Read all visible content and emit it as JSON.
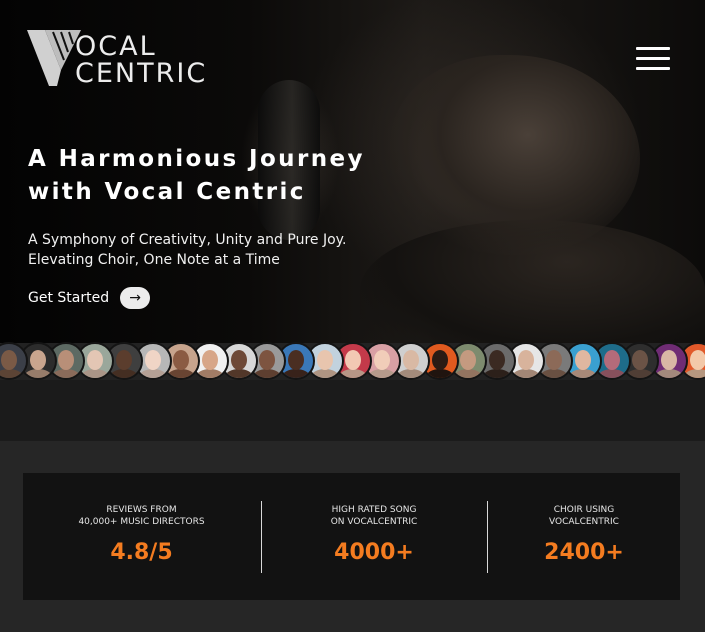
{
  "brand": {
    "line1": "OCAL",
    "line2": "CENTRIC",
    "icon": "v-logo-mark"
  },
  "header": {
    "menu_icon": "hamburger-menu-icon"
  },
  "hero": {
    "title_line1": "A Harmonious Journey",
    "title_line2": "with Vocal Centric",
    "subtitle_line1": "A Symphony of Creativity, Unity and Pure Joy.",
    "subtitle_line2": "Elevating Choir, One Note at a Time",
    "cta_label": "Get Started",
    "cta_icon": "arrow-right-icon",
    "cta_arrow_glyph": "→"
  },
  "avatars": [
    {
      "skin": "#7a5a46",
      "bg": "#3b3f48"
    },
    {
      "skin": "#c9a58e",
      "bg": "#2c2c2c"
    },
    {
      "skin": "#b88f78",
      "bg": "#5d6a63"
    },
    {
      "skin": "#e3c6b4",
      "bg": "#9aa79b"
    },
    {
      "skin": "#5b3d2d",
      "bg": "#3f3f3f"
    },
    {
      "skin": "#f0d5c6",
      "bg": "#b7b7b7"
    },
    {
      "skin": "#8b5b43",
      "bg": "#c7a48d"
    },
    {
      "skin": "#d7a688",
      "bg": "#f1f1f1"
    },
    {
      "skin": "#6e4937",
      "bg": "#d8d8d8"
    },
    {
      "skin": "#7d5440",
      "bg": "#9a9a9a"
    },
    {
      "skin": "#4a2e22",
      "bg": "#3a78b8"
    },
    {
      "skin": "#e8c5ae",
      "bg": "#c2d2de"
    },
    {
      "skin": "#f2c8b3",
      "bg": "#c43a4a"
    },
    {
      "skin": "#f1cdb9",
      "bg": "#d8a0a4"
    },
    {
      "skin": "#d9b9a4",
      "bg": "#cfcfcf"
    },
    {
      "skin": "#2a1b14",
      "bg": "#e05a1f"
    },
    {
      "skin": "#c49a80",
      "bg": "#7d8b6e"
    },
    {
      "skin": "#3b2a22",
      "bg": "#6b6b6b"
    },
    {
      "skin": "#d8b39c",
      "bg": "#e6e6e6"
    },
    {
      "skin": "#8c6a58",
      "bg": "#7a7a7a"
    },
    {
      "skin": "#e0b7a0",
      "bg": "#3aa0d0"
    },
    {
      "skin": "#b46b7a",
      "bg": "#1e6c8a"
    },
    {
      "skin": "#6b5346",
      "bg": "#2e2e2e"
    },
    {
      "skin": "#d9b7a5",
      "bg": "#6f2c74"
    },
    {
      "skin": "#f3c9a9",
      "bg": "#e1592a"
    }
  ],
  "stats": [
    {
      "caption": "REVIEWS FROM\n40,000+ MUSIC DIRECTORS",
      "value": "4.8/5"
    },
    {
      "caption": "HIGH RATED SONG\nON VOCALCENTRIC",
      "value": "4000+"
    },
    {
      "caption": "CHOIR USING\nVOCALCENTRIC",
      "value": "2400+"
    }
  ],
  "colors": {
    "accent": "#f47c20",
    "page_bg": "#222222",
    "card_bg": "#121212"
  }
}
